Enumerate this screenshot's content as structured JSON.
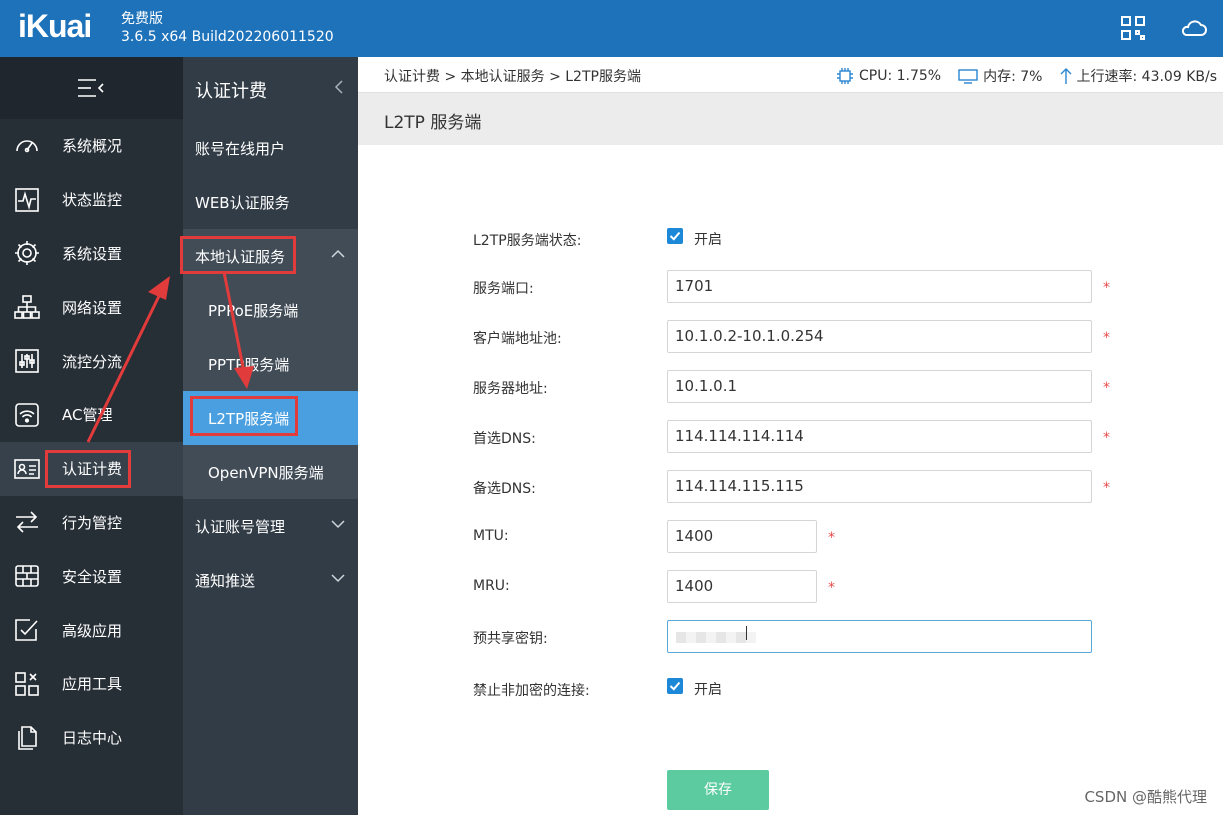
{
  "topbar": {
    "logo": "iKuai",
    "edition": "免费版",
    "version": "3.6.5 x64 Build202206011520"
  },
  "nav": {
    "items": [
      {
        "label": "系统概况",
        "icon": "speedometer-icon"
      },
      {
        "label": "状态监控",
        "icon": "monitor-pulse-icon"
      },
      {
        "label": "系统设置",
        "icon": "gear-icon"
      },
      {
        "label": "网络设置",
        "icon": "network-icon"
      },
      {
        "label": "流控分流",
        "icon": "sliders-icon"
      },
      {
        "label": "AC管理",
        "icon": "wifi-icon"
      },
      {
        "label": "认证计费",
        "icon": "id-card-icon"
      },
      {
        "label": "行为管控",
        "icon": "arrows-swap-icon"
      },
      {
        "label": "安全设置",
        "icon": "firewall-icon"
      },
      {
        "label": "高级应用",
        "icon": "check-screen-icon"
      },
      {
        "label": "应用工具",
        "icon": "tools-grid-icon"
      },
      {
        "label": "日志中心",
        "icon": "document-icon"
      }
    ]
  },
  "subnav": {
    "title": "认证计费",
    "items": [
      {
        "label": "账号在线用户"
      },
      {
        "label": "WEB认证服务"
      },
      {
        "label": "本地认证服务"
      },
      {
        "label": "PPPoE服务端"
      },
      {
        "label": "PPTP服务端"
      },
      {
        "label": "L2TP服务端"
      },
      {
        "label": "OpenVPN服务端"
      },
      {
        "label": "认证账号管理"
      },
      {
        "label": "通知推送"
      }
    ]
  },
  "breadcrumb": "认证计费 > 本地认证服务 > L2TP服务端",
  "stats": {
    "cpu": "CPU: 1.75%",
    "mem": "内存: 7%",
    "upload": "上行速率: 43.09 KB/s"
  },
  "page_title": "L2TP 服务端",
  "form": {
    "status_label": "L2TP服务端状态:",
    "status_text": "开启",
    "port_label": "服务端口:",
    "port_value": "1701",
    "pool_label": "客户端地址池:",
    "pool_value": "10.1.0.2-10.1.0.254",
    "server_label": "服务器地址:",
    "server_value": "10.1.0.1",
    "dns1_label": "首选DNS:",
    "dns1_value": "114.114.114.114",
    "dns2_label": "备选DNS:",
    "dns2_value": "114.114.115.115",
    "mtu_label": "MTU:",
    "mtu_value": "1400",
    "mru_label": "MRU:",
    "mru_value": "1400",
    "psk_label": "预共享密钥:",
    "noenc_label": "禁止非加密的连接:",
    "noenc_text": "开启",
    "required_mark": "*",
    "save": "保存"
  },
  "watermark": "CSDN @酷熊代理",
  "colors": {
    "topbar": "#1e72ba",
    "nav_bg": "#262e36",
    "subnav_bg": "#323c46",
    "active": "#4a9fe0",
    "save": "#5ccba0",
    "annotation": "#e23b3b"
  }
}
